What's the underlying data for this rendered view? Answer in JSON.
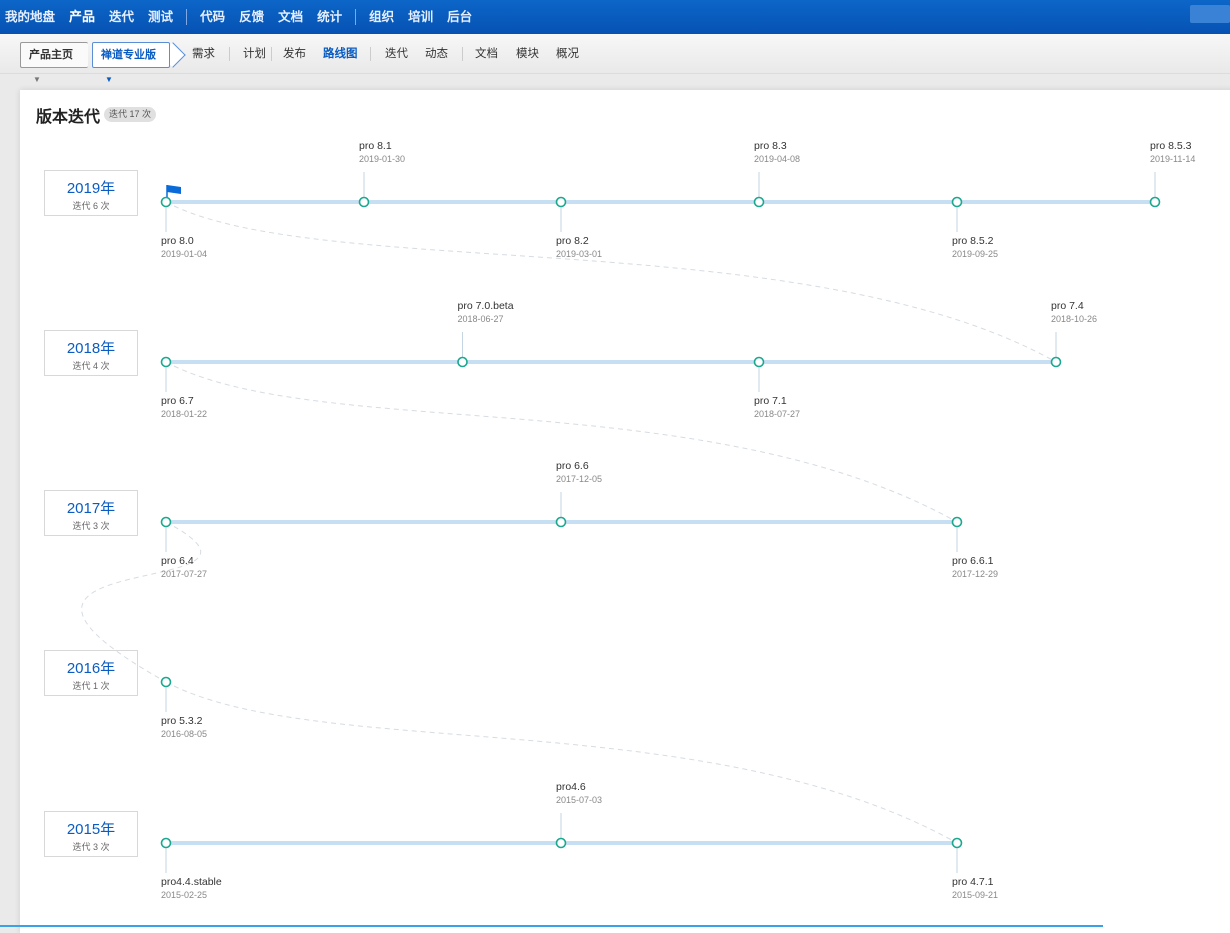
{
  "topnav": {
    "items": [
      "我的地盘",
      "产品",
      "迭代",
      "测试",
      "代码",
      "反馈",
      "文档",
      "统计",
      "组织",
      "培训",
      "后台"
    ],
    "active_index": 1,
    "separators_after": [
      3,
      7
    ]
  },
  "subnav": {
    "crumb_home": "产品主页",
    "crumb_product": "禅道专业版",
    "items": [
      "需求",
      "计划",
      "发布",
      "路线图",
      "迭代",
      "动态",
      "文档",
      "模块",
      "概况"
    ],
    "active_index": 3
  },
  "panel": {
    "title": "版本迭代",
    "badge": "迭代 17 次"
  },
  "colors": {
    "accent": "#0a5cc2",
    "node": "#1aa88f",
    "track": "#c7dff2",
    "flag": "#0a6ad8"
  },
  "years": [
    {
      "year": "2019年",
      "count": "迭代 6 次",
      "versions": [
        {
          "name": "pro 8.0",
          "date": "2019-01-04",
          "side": "below",
          "flag": true
        },
        {
          "name": "pro 8.1",
          "date": "2019-01-30",
          "side": "above"
        },
        {
          "name": "pro 8.2",
          "date": "2019-03-01",
          "side": "below"
        },
        {
          "name": "pro 8.3",
          "date": "2019-04-08",
          "side": "above"
        },
        {
          "name": "pro 8.5.2",
          "date": "2019-09-25",
          "side": "below"
        },
        {
          "name": "pro 8.5.3",
          "date": "2019-11-14",
          "side": "above"
        }
      ]
    },
    {
      "year": "2018年",
      "count": "迭代 4 次",
      "versions": [
        {
          "name": "pro 6.7",
          "date": "2018-01-22",
          "side": "below"
        },
        {
          "name": "pro 7.0.beta",
          "date": "2018-06-27",
          "side": "above"
        },
        {
          "name": "pro 7.1",
          "date": "2018-07-27",
          "side": "below"
        },
        {
          "name": "pro 7.4",
          "date": "2018-10-26",
          "side": "above"
        }
      ]
    },
    {
      "year": "2017年",
      "count": "迭代 3 次",
      "versions": [
        {
          "name": "pro 6.4",
          "date": "2017-07-27",
          "side": "below"
        },
        {
          "name": "pro 6.6",
          "date": "2017-12-05",
          "side": "above"
        },
        {
          "name": "pro 6.6.1",
          "date": "2017-12-29",
          "side": "below"
        }
      ]
    },
    {
      "year": "2016年",
      "count": "迭代 1 次",
      "versions": [
        {
          "name": "pro 5.3.2",
          "date": "2016-08-05",
          "side": "below"
        }
      ]
    },
    {
      "year": "2015年",
      "count": "迭代 3 次",
      "versions": [
        {
          "name": "pro4.4.stable",
          "date": "2015-02-25",
          "side": "below"
        },
        {
          "name": "pro4.6",
          "date": "2015-07-03",
          "side": "above"
        },
        {
          "name": "pro 4.7.1",
          "date": "2015-09-21",
          "side": "below"
        }
      ]
    }
  ]
}
